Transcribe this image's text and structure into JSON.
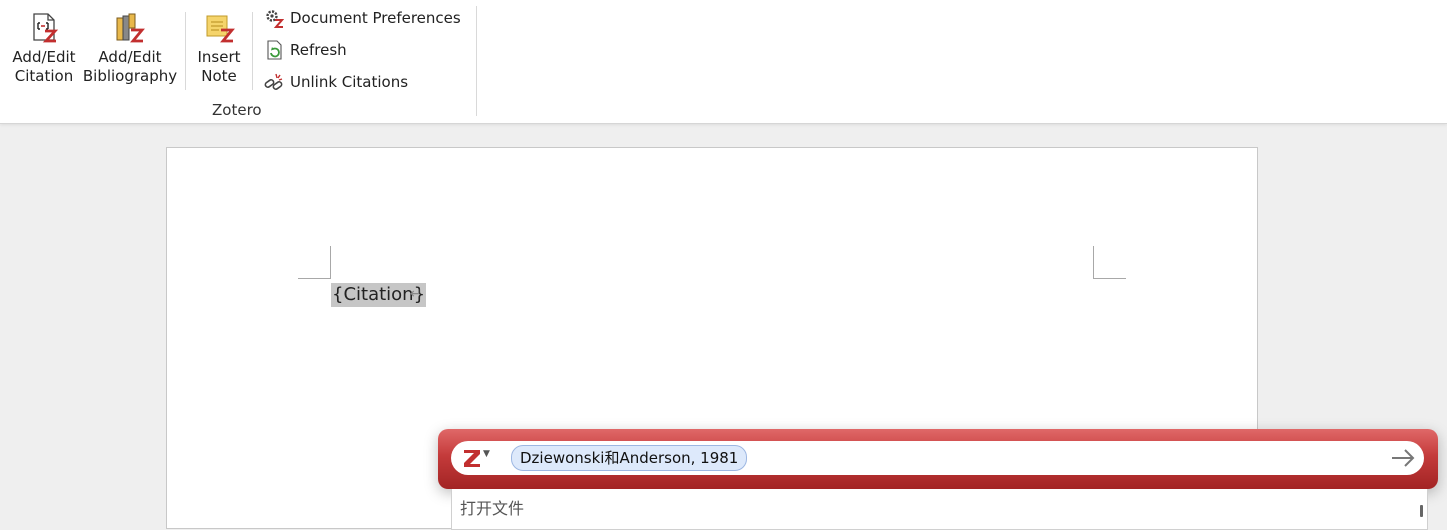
{
  "ribbon": {
    "add_edit_citation": [
      "Add/Edit",
      "Citation"
    ],
    "add_edit_bibliography": [
      "Add/Edit",
      "Bibliography"
    ],
    "insert_note": [
      "Insert",
      "Note"
    ],
    "document_preferences": "Document Preferences",
    "refresh": "Refresh",
    "unlink_citations": "Unlink Citations",
    "group_label": "Zotero"
  },
  "document": {
    "citation_field": "{Citation}",
    "paragraph_mark": "↵"
  },
  "quick_format": {
    "citation_bubble": "Dziewonski和Anderson, 1981",
    "suggestion": "打开文件"
  },
  "colors": {
    "zotero_red": "#c22f2f",
    "bubble_blue": "#dde9fb"
  }
}
